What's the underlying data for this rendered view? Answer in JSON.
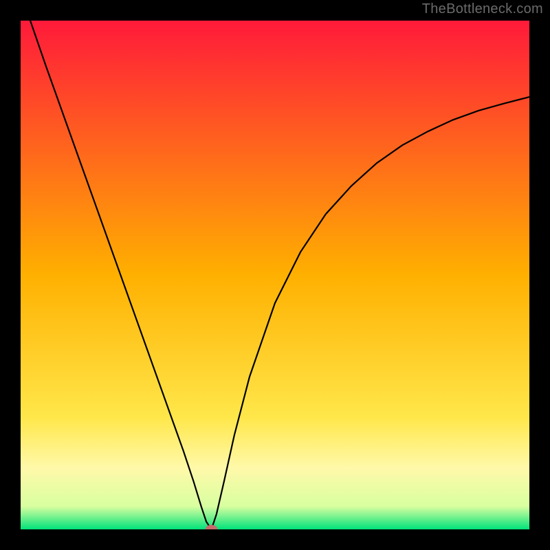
{
  "watermark": "TheBottleneck.com",
  "chart_data": {
    "type": "line",
    "title": "",
    "xlabel": "",
    "ylabel": "",
    "xlim": [
      0,
      1
    ],
    "ylim": [
      0,
      1
    ],
    "background": {
      "style": "vertical-gradient",
      "stops": [
        {
          "offset": 0.0,
          "color": "#ff1a3a"
        },
        {
          "offset": 0.5,
          "color": "#ffb000"
        },
        {
          "offset": 0.78,
          "color": "#ffe74a"
        },
        {
          "offset": 0.88,
          "color": "#fff9aa"
        },
        {
          "offset": 0.955,
          "color": "#d8ffa0"
        },
        {
          "offset": 1.0,
          "color": "#00e27a"
        }
      ]
    },
    "series": [
      {
        "name": "bottleneck-curve",
        "x": [
          0.0,
          0.05,
          0.1,
          0.15,
          0.2,
          0.25,
          0.28,
          0.3,
          0.32,
          0.34,
          0.355,
          0.365,
          0.375,
          0.385,
          0.4,
          0.42,
          0.45,
          0.5,
          0.55,
          0.6,
          0.65,
          0.7,
          0.75,
          0.8,
          0.85,
          0.9,
          0.95,
          1.0
        ],
        "y": [
          1.055,
          0.91,
          0.77,
          0.63,
          0.49,
          0.35,
          0.266,
          0.21,
          0.154,
          0.094,
          0.045,
          0.015,
          0.0,
          0.03,
          0.095,
          0.185,
          0.3,
          0.445,
          0.545,
          0.62,
          0.675,
          0.72,
          0.755,
          0.782,
          0.805,
          0.823,
          0.837,
          0.85
        ]
      }
    ],
    "marker": {
      "x": 0.375,
      "y": 0.0,
      "rx": 0.012,
      "ry": 0.009,
      "color": "#c76b6b"
    }
  }
}
